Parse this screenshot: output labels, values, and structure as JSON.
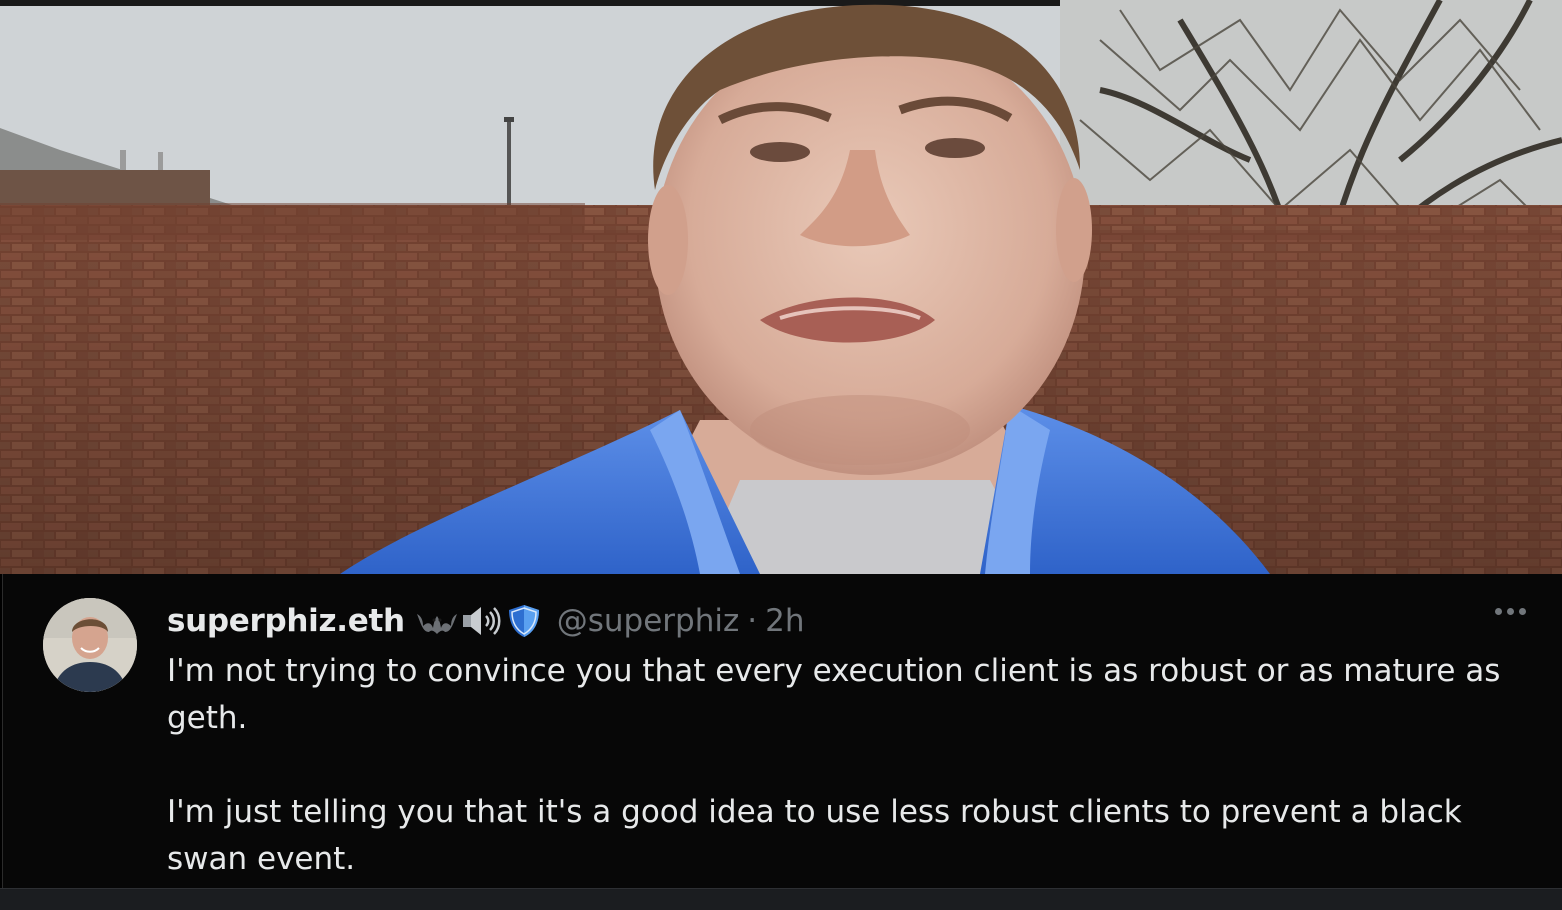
{
  "tweet": {
    "display_name": "superphiz.eth",
    "badges": [
      "bat-icon",
      "speaker-icon",
      "shield-icon"
    ],
    "handle": "@superphiz",
    "separator": "·",
    "time": "2h",
    "paragraphs": [
      "I'm not trying to convince you that every execution client is as robust or as mature as geth.",
      "I'm just telling you that it's a good idea to use less robust clients to prevent a black swan event."
    ]
  },
  "colors": {
    "background": "#070707",
    "text_primary": "#e7e9ea",
    "text_secondary": "#71767b",
    "shield_blue": "#4a90e2"
  }
}
